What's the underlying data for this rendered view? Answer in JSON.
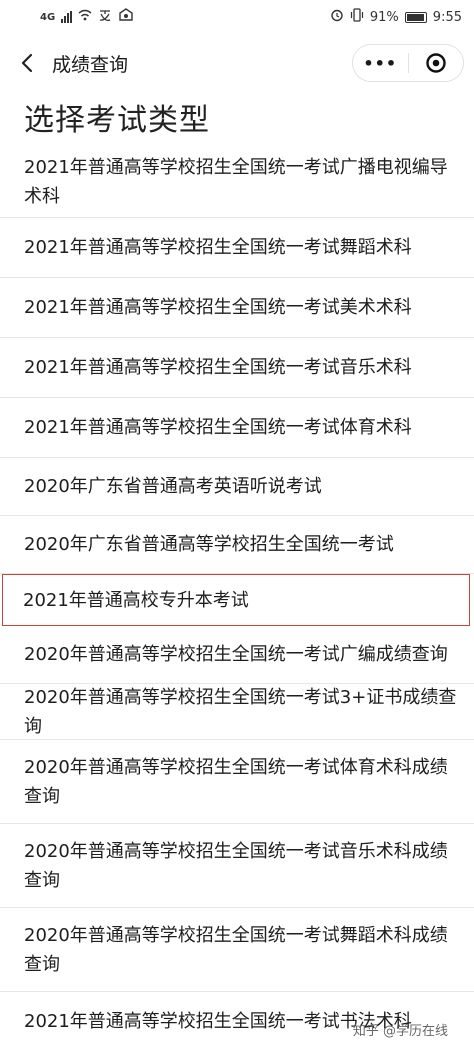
{
  "status_bar": {
    "network": "4G",
    "battery": "91%",
    "time": "9:55"
  },
  "nav": {
    "title": "成绩查询",
    "more_label": "•••"
  },
  "page_title": "选择考试类型",
  "items": [
    {
      "label": "2021年普通高等学校招生全国统一考试广播电视编导术科",
      "selected": false
    },
    {
      "label": "2021年普通高等学校招生全国统一考试舞蹈术科",
      "selected": false
    },
    {
      "label": "2021年普通高等学校招生全国统一考试美术术科",
      "selected": false
    },
    {
      "label": "2021年普通高等学校招生全国统一考试音乐术科",
      "selected": false
    },
    {
      "label": "2021年普通高等学校招生全国统一考试体育术科",
      "selected": false
    },
    {
      "label": "2020年广东省普通高考英语听说考试",
      "selected": false
    },
    {
      "label": "2020年广东省普通高等学校招生全国统一考试",
      "selected": false
    },
    {
      "label": "2021年普通高校专升本考试",
      "selected": true
    },
    {
      "label": "2020年普通高等学校招生全国统一考试广编成绩查询",
      "selected": false
    },
    {
      "label": "2020年普通高等学校招生全国统一考试3+证书成绩查询",
      "selected": false
    },
    {
      "label": "2020年普通高等学校招生全国统一考试体育术科成绩查询",
      "selected": false
    },
    {
      "label": "2020年普通高等学校招生全国统一考试音乐术科成绩查询",
      "selected": false
    },
    {
      "label": "2020年普通高等学校招生全国统一考试舞蹈术科成绩查询",
      "selected": false
    },
    {
      "label": "2021年普通高等学校招生全国统一考试书法术科",
      "selected": false
    }
  ],
  "watermark": "知乎 @学历在线"
}
